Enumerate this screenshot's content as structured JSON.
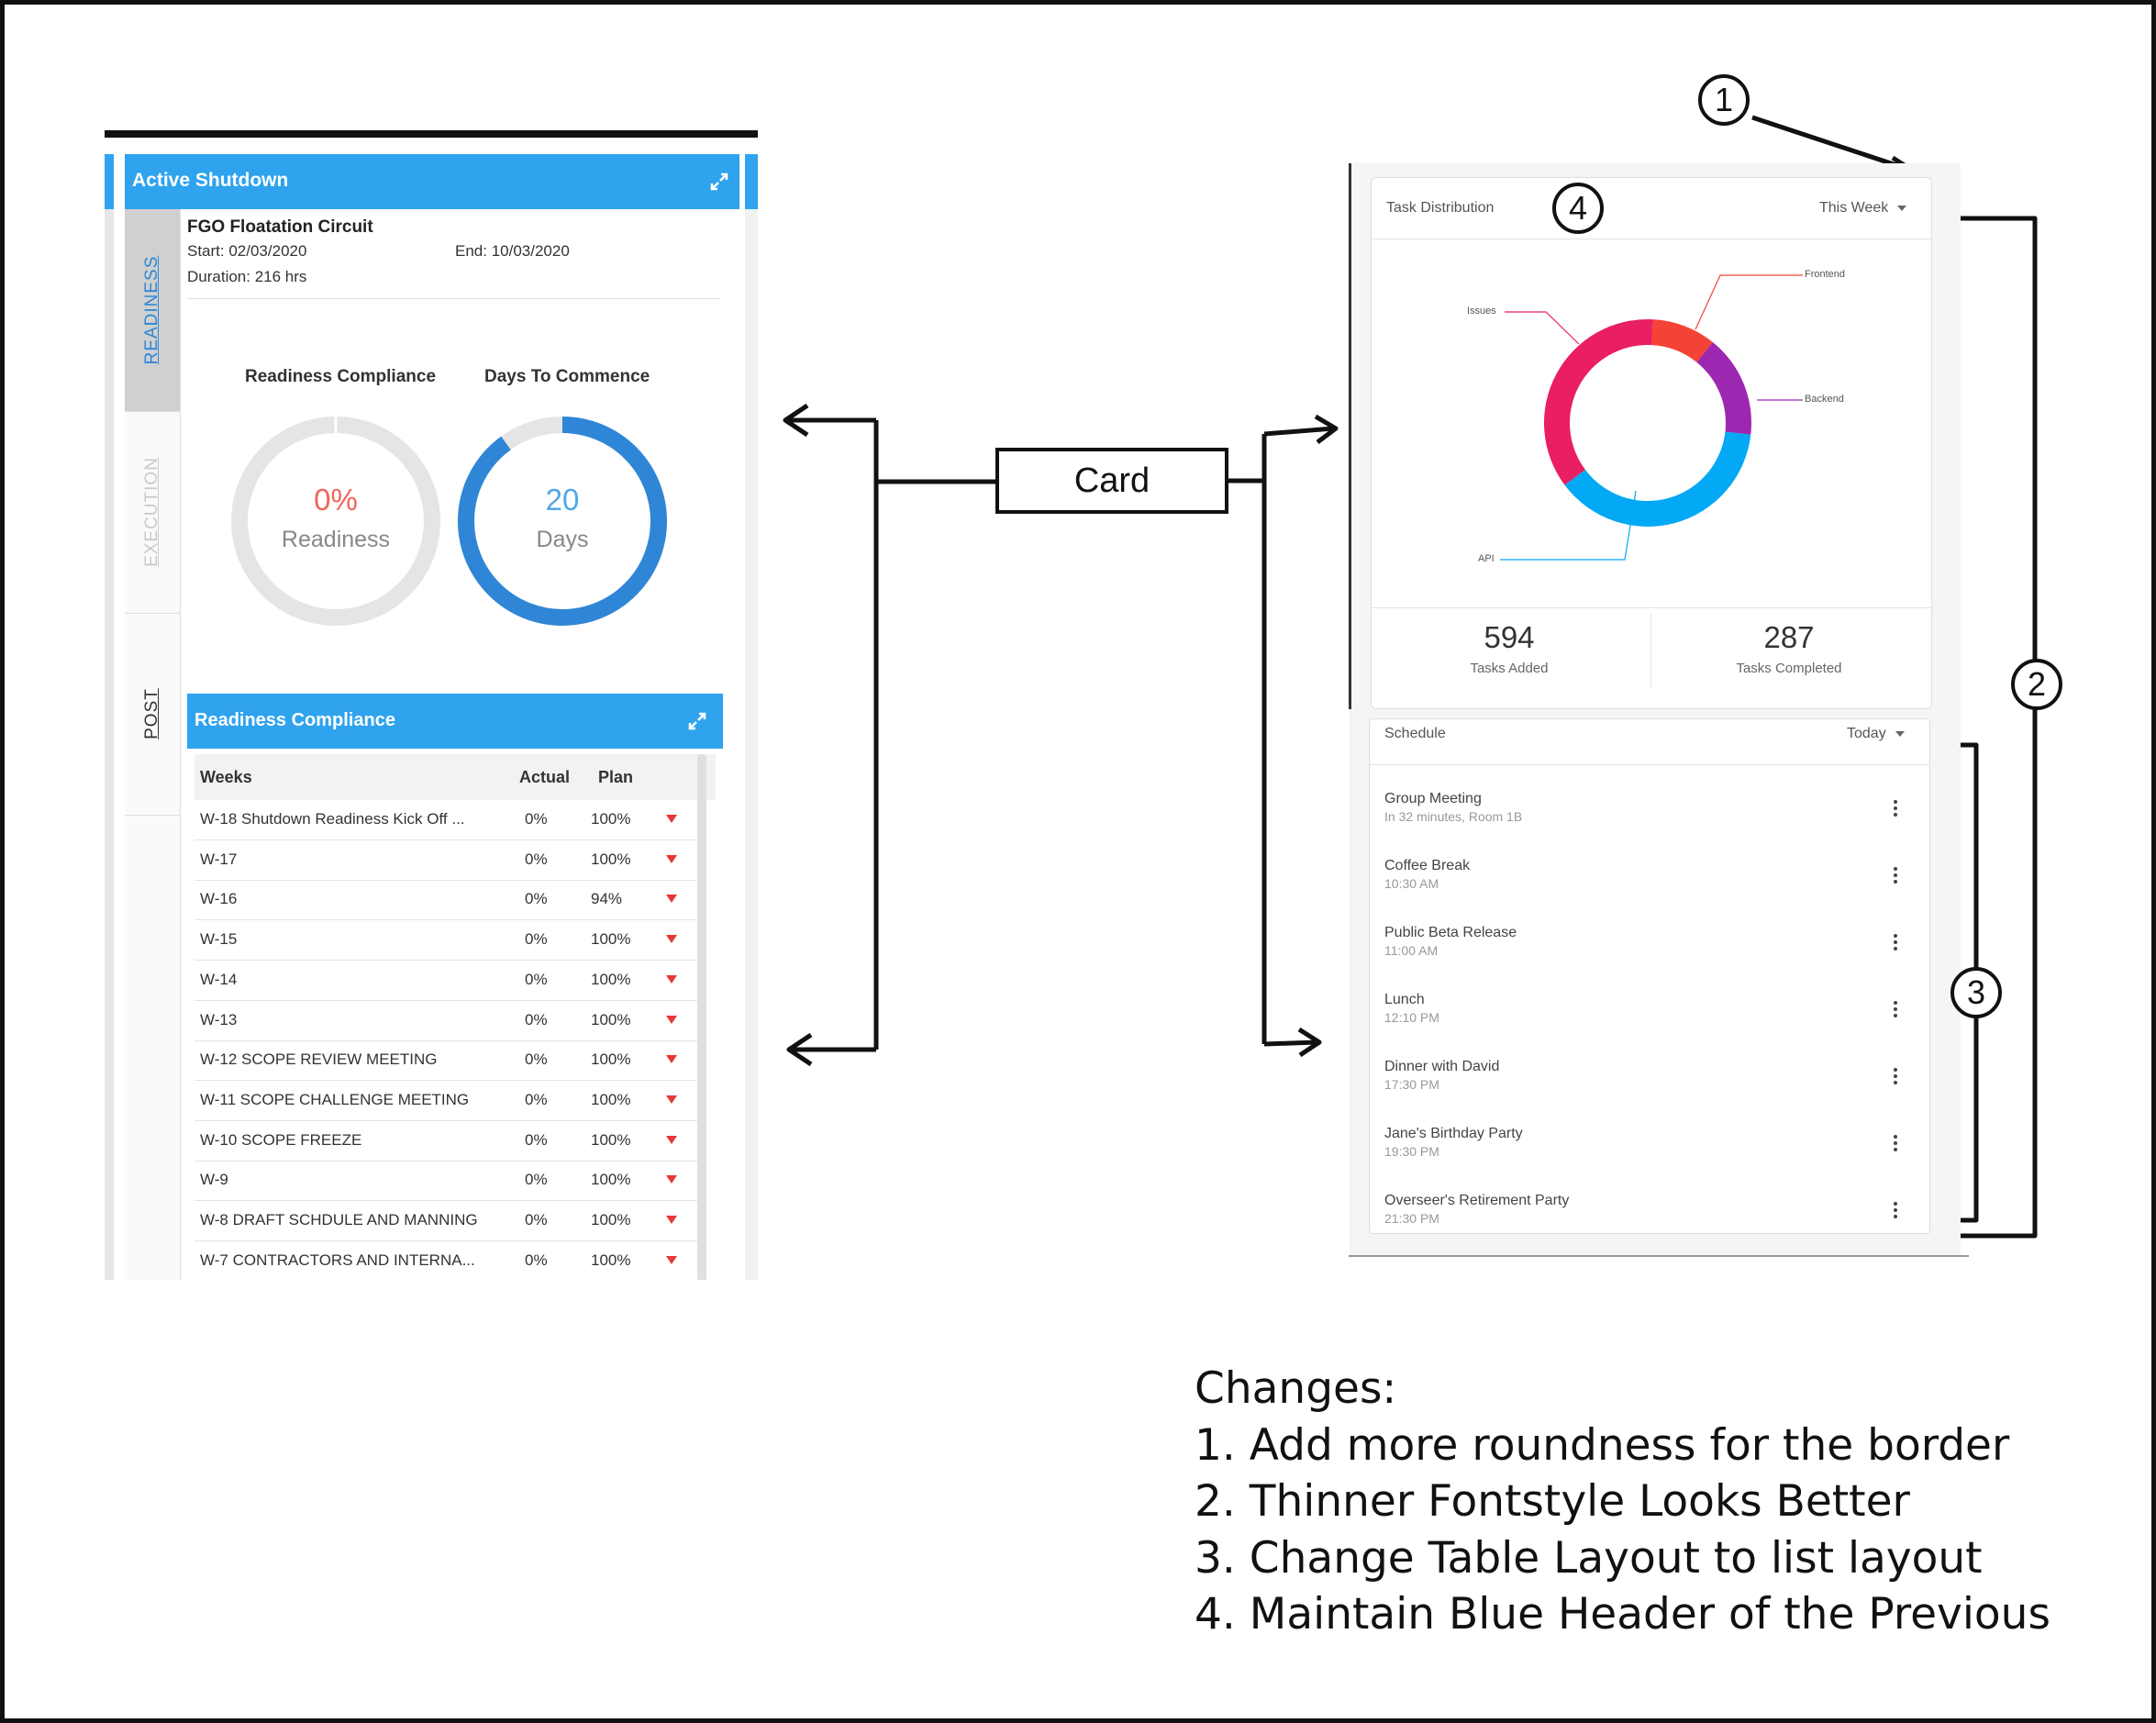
{
  "left": {
    "panel_title": "Active Shutdown",
    "tabs": [
      "READINESS",
      "EXECUTION",
      "POST"
    ],
    "info": {
      "title": "FGO Floatation Circuit",
      "start": "Start: 02/03/2020",
      "end": "End: 10/03/2020",
      "duration": "Duration: 216 hrs"
    },
    "gauges": [
      {
        "label": "Readiness Compliance",
        "value": "0%",
        "sub": "Readiness",
        "fraction": 0.0,
        "color": "#f0645a"
      },
      {
        "label": "Days To Commence",
        "value": "20",
        "sub": "Days",
        "fraction": 0.9,
        "color": "#2f86d6"
      }
    ],
    "table": {
      "title": "Readiness Compliance",
      "headers": [
        "Weeks",
        "Actual",
        "Plan"
      ],
      "rows": [
        {
          "week": "W-18 Shutdown Readiness Kick Off ...",
          "actual": "0%",
          "plan": "100%"
        },
        {
          "week": "W-17",
          "actual": "0%",
          "plan": "100%"
        },
        {
          "week": "W-16",
          "actual": "0%",
          "plan": "94%"
        },
        {
          "week": "W-15",
          "actual": "0%",
          "plan": "100%"
        },
        {
          "week": "W-14",
          "actual": "0%",
          "plan": "100%"
        },
        {
          "week": "W-13",
          "actual": "0%",
          "plan": "100%"
        },
        {
          "week": "W-12 SCOPE REVIEW MEETING",
          "actual": "0%",
          "plan": "100%"
        },
        {
          "week": "W-11 SCOPE CHALLENGE MEETING",
          "actual": "0%",
          "plan": "100%"
        },
        {
          "week": "W-10 SCOPE FREEZE",
          "actual": "0%",
          "plan": "100%"
        },
        {
          "week": "W-9",
          "actual": "0%",
          "plan": "100%"
        },
        {
          "week": "W-8 DRAFT SCHDULE AND MANNING",
          "actual": "0%",
          "plan": "100%"
        },
        {
          "week": "W-7 CONTRACTORS AND INTERNA...",
          "actual": "0%",
          "plan": "100%"
        }
      ]
    }
  },
  "callout": {
    "card_label": "Card"
  },
  "right": {
    "task_card": {
      "title": "Task Distribution",
      "period": "This Week",
      "donut": [
        {
          "label": "Frontend",
          "fraction": 0.1,
          "color": "#f44336"
        },
        {
          "label": "Backend",
          "fraction": 0.16,
          "color": "#9c27b0"
        },
        {
          "label": "API",
          "fraction": 0.38,
          "color": "#03a9f4"
        },
        {
          "label": "Issues",
          "fraction": 0.36,
          "color": "#e91e63"
        }
      ],
      "stats": [
        {
          "value": "594",
          "label": "Tasks Added"
        },
        {
          "value": "287",
          "label": "Tasks Completed"
        }
      ]
    },
    "schedule_card": {
      "title": "Schedule",
      "period": "Today",
      "items": [
        {
          "title": "Group Meeting",
          "sub": "In 32 minutes, Room 1B"
        },
        {
          "title": "Coffee Break",
          "sub": "10:30 AM"
        },
        {
          "title": "Public Beta Release",
          "sub": "11:00 AM"
        },
        {
          "title": "Lunch",
          "sub": "12:10 PM"
        },
        {
          "title": "Dinner with David",
          "sub": "17:30 PM"
        },
        {
          "title": "Jane's Birthday Party",
          "sub": "19:30 PM"
        },
        {
          "title": "Overseer's Retirement Party",
          "sub": "21:30 PM"
        }
      ]
    }
  },
  "annotations": {
    "numbers": [
      "1",
      "2",
      "3",
      "4"
    ],
    "changes_title": "Changes:",
    "changes": [
      "1. Add more roundness for the border",
      "2. Thinner Fontstyle Looks Better",
      "3. Change Table Layout to list layout",
      "4. Maintain Blue Header of the Previous"
    ]
  }
}
